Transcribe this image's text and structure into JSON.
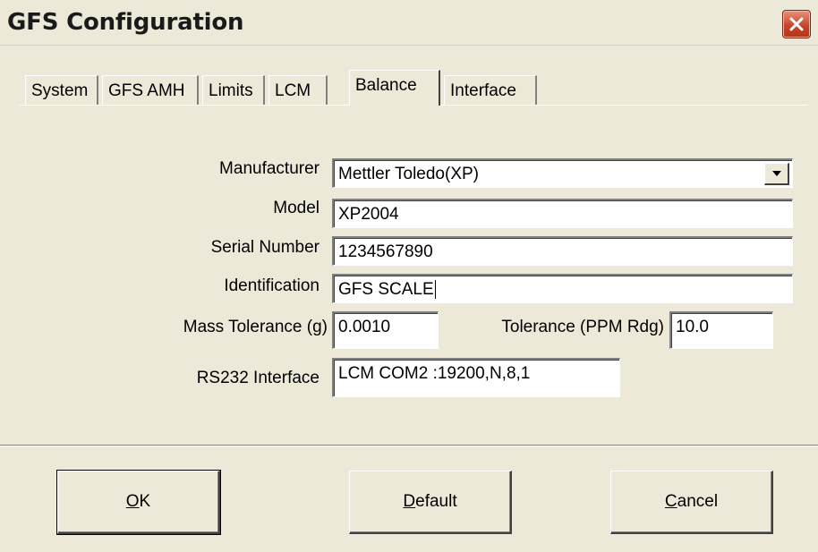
{
  "window": {
    "title": "GFS Configuration",
    "close_icon": "close-icon"
  },
  "tabs": [
    {
      "label": "System",
      "active": false
    },
    {
      "label": "GFS AMH",
      "active": false
    },
    {
      "label": "Limits",
      "active": false
    },
    {
      "label": "LCM",
      "active": false
    },
    {
      "label": "Balance",
      "active": true
    },
    {
      "label": "Interface",
      "active": false
    }
  ],
  "form": {
    "manufacturer_label": "Manufacturer",
    "manufacturer_value": "Mettler Toledo(XP)",
    "model_label": "Model",
    "model_value": "XP2004",
    "serial_label": "Serial Number",
    "serial_value": "1234567890",
    "identification_label": "Identification",
    "identification_value": "GFS SCALE",
    "mass_tolerance_label": "Mass Tolerance (g)",
    "mass_tolerance_value": "0.0010",
    "tolerance_ppm_label": "Tolerance (PPM Rdg)",
    "tolerance_ppm_value": "10.0",
    "rs232_label": "RS232 Interface",
    "rs232_value": "LCM COM2 :19200,N,8,1"
  },
  "buttons": {
    "ok_mnemonic": "O",
    "ok_rest": "K",
    "default_mnemonic": "D",
    "default_rest": "efault",
    "cancel_mnemonic": "C",
    "cancel_rest": "ancel"
  },
  "colors": {
    "window_bg": "#ece9d8",
    "close_button": "#c8462b"
  }
}
